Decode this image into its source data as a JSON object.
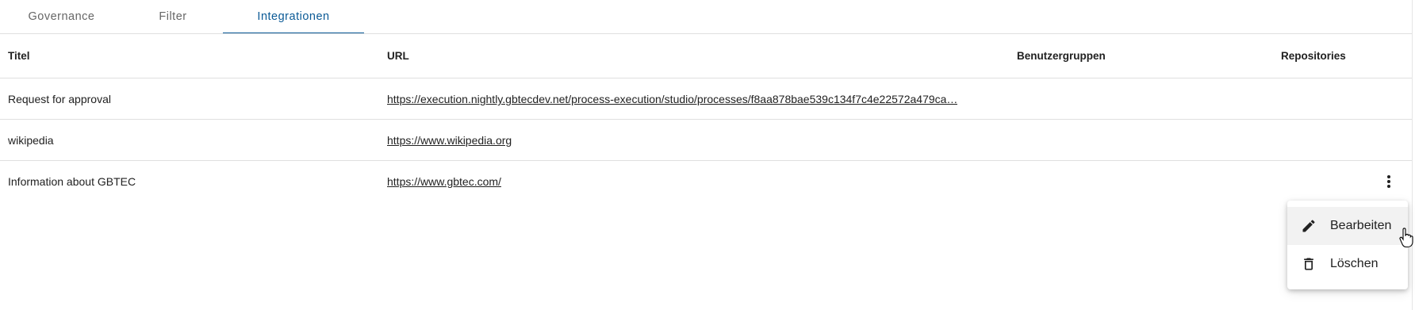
{
  "tabs": [
    {
      "label": "Governance",
      "active": false
    },
    {
      "label": "Filter",
      "active": false
    },
    {
      "label": "Integrationen",
      "active": true
    }
  ],
  "table": {
    "columns": {
      "title": "Titel",
      "url": "URL",
      "groups": "Benutzergruppen",
      "repositories": "Repositories"
    },
    "rows": [
      {
        "title": "Request for approval",
        "url": "https://execution.nightly.gbtecdev.net/process-execution/studio/processes/f8aa878bae539c134f7c4e22572a479ca…"
      },
      {
        "title": "wikipedia",
        "url": "https://www.wikipedia.org"
      },
      {
        "title": "Information about GBTEC",
        "url": "https://www.gbtec.com/"
      }
    ]
  },
  "menu": {
    "items": [
      {
        "label": "Bearbeiten",
        "icon": "pencil-icon"
      },
      {
        "label": "Löschen",
        "icon": "trash-icon"
      }
    ]
  },
  "colors": {
    "accent": "#0b5a96",
    "divider": "#e0e0e0"
  }
}
